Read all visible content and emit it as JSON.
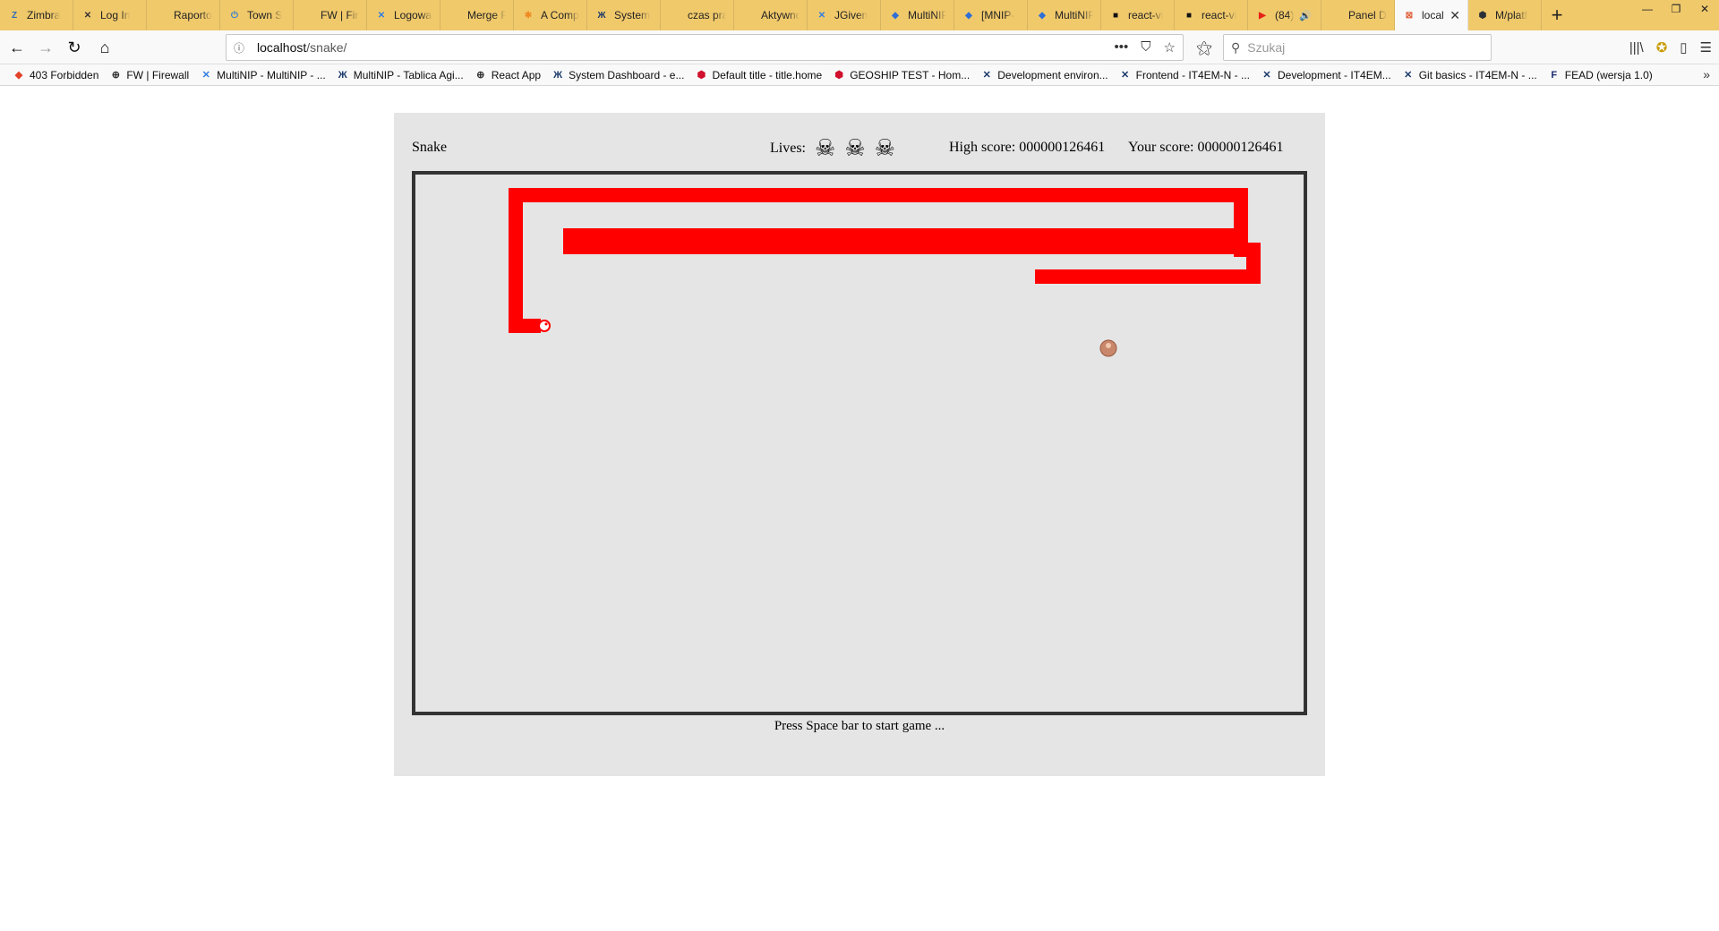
{
  "browser": {
    "tabs": [
      {
        "label": "Zimbra",
        "icon": "zimbra-icon",
        "color": "#2a6ebb",
        "glyph": "Z"
      },
      {
        "label": "Log In",
        "icon": "confluence-x-icon",
        "color": "#333333",
        "glyph": "✕"
      },
      {
        "label": "Raportowanie",
        "icon": "blank-icon",
        "color": "",
        "glyph": ""
      },
      {
        "label": "Town S",
        "icon": "power-icon",
        "color": "#2a7bd6",
        "glyph": "⏻"
      },
      {
        "label": "FW | Firewall",
        "icon": "blank-icon",
        "color": "",
        "glyph": ""
      },
      {
        "label": "Logowanie",
        "icon": "jira-icon",
        "color": "#2f7de1",
        "glyph": "✕"
      },
      {
        "label": "Merge Requests",
        "icon": "blank-icon",
        "color": "",
        "glyph": ""
      },
      {
        "label": "A Comp",
        "icon": "asterisk-icon",
        "color": "#f08a24",
        "glyph": "✱"
      },
      {
        "label": "System",
        "icon": "system-icon",
        "color": "#1b3a6b",
        "glyph": "Ж"
      },
      {
        "label": "czas pracy",
        "icon": "blank-icon",
        "color": "",
        "glyph": ""
      },
      {
        "label": "Aktywnosc",
        "icon": "blank-icon",
        "color": "",
        "glyph": ""
      },
      {
        "label": "JGiven",
        "icon": "jira-icon",
        "color": "#2f7de1",
        "glyph": "✕"
      },
      {
        "label": "MultiNIP",
        "icon": "diamond-icon",
        "color": "#2f6fd6",
        "glyph": "◆"
      },
      {
        "label": "[MNIP-",
        "icon": "diamond-icon",
        "color": "#2f6fd6",
        "glyph": "◆"
      },
      {
        "label": "MultiNIP",
        "icon": "diamond-icon",
        "color": "#2f6fd6",
        "glyph": "◆"
      },
      {
        "label": "react-vi",
        "icon": "square-icon",
        "color": "#111111",
        "glyph": "■"
      },
      {
        "label": "react-vi",
        "icon": "square-icon",
        "color": "#111111",
        "glyph": "■"
      },
      {
        "label": "(84)",
        "icon": "youtube-icon",
        "color": "#e62117",
        "glyph": "▶",
        "audio": "🔊"
      },
      {
        "label": "Panel Detali",
        "icon": "blank-icon",
        "color": "",
        "glyph": ""
      },
      {
        "label": "localhost",
        "icon": "localhost-icon",
        "color": "#e0603a",
        "glyph": "⊠",
        "active": true,
        "close": "✕"
      },
      {
        "label": "M/platf",
        "icon": "github-icon",
        "color": "#2b3137",
        "glyph": "⬢"
      }
    ],
    "new_tab": "+",
    "window_controls": {
      "minimize": "—",
      "restore": "❐",
      "close": "✕"
    },
    "nav": {
      "back": "←",
      "forward": "→",
      "reload": "↻",
      "home": "⌂"
    },
    "url": {
      "host": "localhost",
      "path": "/snake/",
      "info": "ⓘ",
      "menu": "•••",
      "pocket": "⛉",
      "star": "☆"
    },
    "search": {
      "placeholder": "Szukaj",
      "icon": "⚲"
    },
    "toolbar_icons": {
      "library": "|||\\",
      "extension": "✪",
      "sidebar": "▯",
      "menu": "☰",
      "reading": "⚝"
    },
    "bookmarks": [
      {
        "label": "403 Forbidden",
        "icon": "gitlab-icon",
        "color": "#e24329",
        "glyph": "◆"
      },
      {
        "label": "FW | Firewall",
        "icon": "globe-icon",
        "color": "#333333",
        "glyph": "⊕"
      },
      {
        "label": "MultiNIP - MultiNIP - ...",
        "icon": "jira-icon",
        "color": "#2f7de1",
        "glyph": "✕"
      },
      {
        "label": "MultiNIP - Tablica Agi...",
        "icon": "system-icon",
        "color": "#1b3a6b",
        "glyph": "Ж"
      },
      {
        "label": "React App",
        "icon": "globe-icon",
        "color": "#333333",
        "glyph": "⊕"
      },
      {
        "label": "System Dashboard - e...",
        "icon": "system-icon",
        "color": "#1b3a6b",
        "glyph": "Ж"
      },
      {
        "label": "Default title - title.home",
        "icon": "cube-icon",
        "color": "#d0102c",
        "glyph": "⬢"
      },
      {
        "label": "GEOSHIP TEST - Hom...",
        "icon": "cube-icon",
        "color": "#d0102c",
        "glyph": "⬢"
      },
      {
        "label": "Development environ...",
        "icon": "confluence-x-icon",
        "color": "#1b3a6b",
        "glyph": "✕"
      },
      {
        "label": "Frontend - IT4EM-N - ...",
        "icon": "confluence-x-icon",
        "color": "#1b3a6b",
        "glyph": "✕"
      },
      {
        "label": "Development - IT4EM...",
        "icon": "confluence-x-icon",
        "color": "#1b3a6b",
        "glyph": "✕"
      },
      {
        "label": "Git basics - IT4EM-N - ...",
        "icon": "confluence-x-icon",
        "color": "#1b3a6b",
        "glyph": "✕"
      },
      {
        "label": "FEAD (wersja 1.0)",
        "icon": "fead-icon",
        "color": "#1b2a6b",
        "glyph": "F"
      }
    ],
    "bookmarks_more": "»"
  },
  "game": {
    "title": "Snake",
    "lives_label": "Lives:",
    "lives": [
      "☠",
      "☠",
      "☠"
    ],
    "high_score": "High score: 000000126461",
    "your_score": "Your score: 000000126461",
    "hint": "Press Space bar to start game ...",
    "snake_color": "#ff0000",
    "food_color": "#c8866a",
    "board_border": "#333333",
    "background": "#e5e5e5"
  }
}
